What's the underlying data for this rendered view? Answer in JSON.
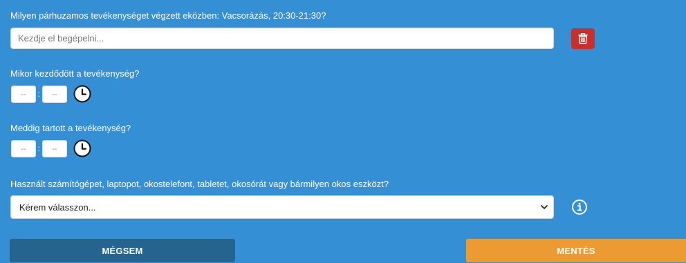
{
  "parallel_activity": {
    "question": "Milyen párhuzamos tevékenységet végzett eközben: Vacsorázás, 20:30-21:30?",
    "input_placeholder": "Kezdje el begépelni...",
    "input_value": ""
  },
  "start_time": {
    "question": "Mikor kezdődött a tevékenység?",
    "hour": "--",
    "minute": "--",
    "separator": ":"
  },
  "end_time": {
    "question": "Meddig tartott a tevékenység?",
    "hour": "--",
    "minute": "--",
    "separator": ":"
  },
  "device_usage": {
    "question": "Használt számítógépet, laptopot, okostelefont, tabletet, okosórát vagy bármilyen okos eszközt?",
    "selected": "Kérem válasszon..."
  },
  "actions": {
    "cancel_label": "MÉGSEM",
    "save_label": "MENTÉS"
  },
  "icons": {
    "delete": "trash-icon",
    "clock": "clock-icon",
    "info": "info-icon",
    "dropdown": "chevron-down-icon"
  },
  "colors": {
    "background": "#358fd4",
    "delete_button": "#c9302c",
    "cancel_button": "#24648f",
    "save_button": "#ec9b32"
  }
}
